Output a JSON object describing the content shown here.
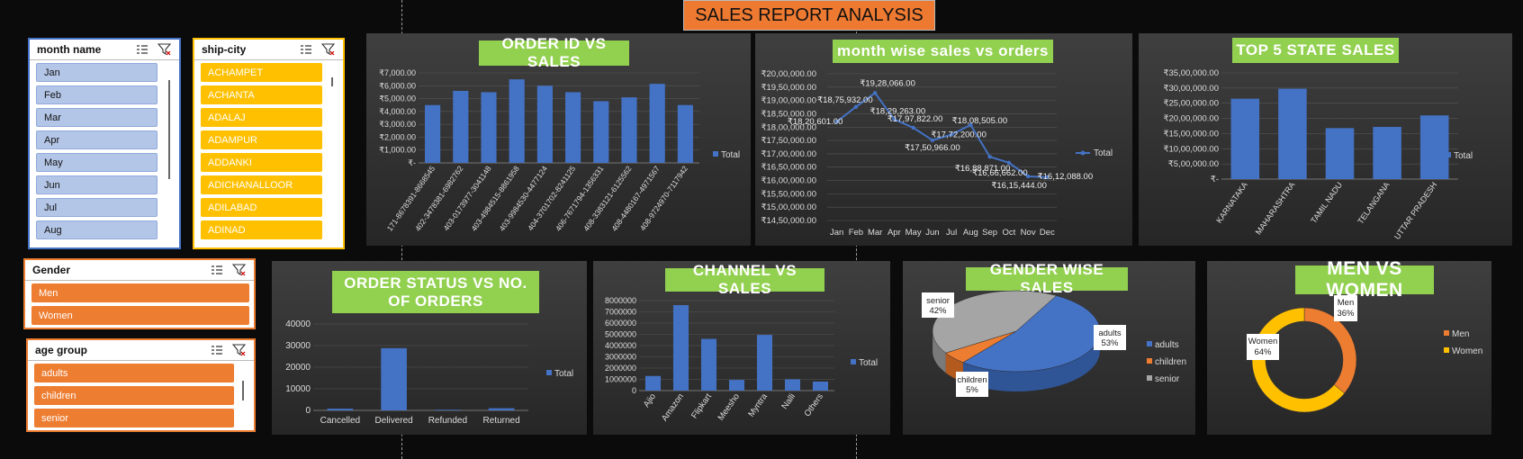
{
  "report_title": "SALES REPORT ANALYSIS",
  "colors": {
    "bar": "#4472c4",
    "title_bg": "#92d050",
    "orange": "#ed7d31",
    "yellow": "#ffc000",
    "banner": "#ee7a32",
    "grey": "#a5a5a5"
  },
  "slicers": {
    "month": {
      "title": "month name",
      "items": [
        "Jan",
        "Feb",
        "Mar",
        "Apr",
        "May",
        "Jun",
        "Jul",
        "Aug"
      ]
    },
    "city": {
      "title": "ship-city",
      "items": [
        "ACHAMPET",
        "ACHANTA",
        "ADALAJ",
        "ADAMPUR",
        "ADDANKI",
        "ADICHANALLOOR",
        "ADILABAD",
        "ADINAD"
      ]
    },
    "gender": {
      "title": "Gender",
      "items": [
        "Men",
        "Women"
      ]
    },
    "age": {
      "title": "age group",
      "items": [
        "adults",
        "children",
        "senior"
      ]
    }
  },
  "chart_data": [
    {
      "id": "order_sales",
      "type": "bar",
      "title": "ORDER ID VS SALES",
      "categories": [
        "171-8678391-8668545",
        "402-3478381-6982762",
        "403-0173977-3041148",
        "403-4984515-8861958",
        "403-9984530-4477124",
        "404-3701702-8241125",
        "406-7671794-1356331",
        "408-3383121-6125562",
        "408-4480167-4971567",
        "408-9724970-7117942"
      ],
      "values": [
        4500,
        5600,
        5500,
        6500,
        6000,
        5500,
        4800,
        5100,
        6150,
        4500
      ],
      "yticks": [
        "₹-",
        "₹1,000.00",
        "₹2,000.00",
        "₹3,000.00",
        "₹4,000.00",
        "₹5,000.00",
        "₹6,000.00",
        "₹7,000.00"
      ],
      "ylim": [
        0,
        7000
      ],
      "legend": "Total"
    },
    {
      "id": "month_sales",
      "type": "line",
      "title": "month wise sales vs orders",
      "categories": [
        "Jan",
        "Feb",
        "Mar",
        "Apr",
        "May",
        "Jun",
        "Jul",
        "Aug",
        "Sep",
        "Oct",
        "Nov",
        "Dec"
      ],
      "values": [
        1820601,
        1875932,
        1928066,
        1829263,
        1797822,
        1750966,
        1772200,
        1808505,
        1688871,
        1666662,
        1615444,
        1612088
      ],
      "labels": [
        "₹18,20,601.00",
        "₹18,75,932.00",
        "₹19,28,066.00",
        "₹18,29,263.00",
        "₹17,97,822.00",
        "₹17,50,966.00",
        "₹17,72,200.00",
        "₹18,08,505.00",
        "₹16,88,871.00",
        "₹16,66,662.00",
        "₹16,15,444.00",
        "₹16,12,088.00"
      ],
      "yticks": [
        "₹14,50,000.00",
        "₹15,00,000.00",
        "₹15,50,000.00",
        "₹16,00,000.00",
        "₹16,50,000.00",
        "₹17,00,000.00",
        "₹17,50,000.00",
        "₹18,00,000.00",
        "₹18,50,000.00",
        "₹19,00,000.00",
        "₹19,50,000.00",
        "₹20,00,000.00"
      ],
      "ylim": [
        1450000,
        2000000
      ],
      "legend": "Total"
    },
    {
      "id": "state_sales",
      "type": "bar",
      "title": "TOP 5 STATE SALES",
      "categories": [
        "KARNATAKA",
        "MAHARASHTRA",
        "TAMIL NADU",
        "TELANGANA",
        "UTTAR PRADESH"
      ],
      "values": [
        2650000,
        2980000,
        1680000,
        1720000,
        2100000
      ],
      "yticks": [
        "₹-",
        "₹5,00,000.00",
        "₹10,00,000.00",
        "₹15,00,000.00",
        "₹20,00,000.00",
        "₹25,00,000.00",
        "₹30,00,000.00",
        "₹35,00,000.00"
      ],
      "ylim": [
        0,
        3500000
      ],
      "legend": "Total"
    },
    {
      "id": "status_orders",
      "type": "bar",
      "title": "ORDER STATUS VS NO. OF ORDERS",
      "categories": [
        "Cancelled",
        "Delivered",
        "Refunded",
        "Returned"
      ],
      "values": [
        800,
        28800,
        300,
        1000
      ],
      "yticks": [
        "0",
        "10000",
        "20000",
        "30000",
        "40000"
      ],
      "ylim": [
        0,
        40000
      ],
      "legend": "Total"
    },
    {
      "id": "channel_sales",
      "type": "bar",
      "title": "CHANNEL VS SALES",
      "categories": [
        "Ajio",
        "Amazon",
        "Flipkart",
        "Meesho",
        "Myntra",
        "Nalli",
        "Others"
      ],
      "values": [
        1300000,
        7600000,
        4600000,
        950000,
        4950000,
        1000000,
        800000
      ],
      "yticks": [
        "0",
        "1000000",
        "2000000",
        "3000000",
        "4000000",
        "5000000",
        "6000000",
        "7000000",
        "8000000"
      ],
      "ylim": [
        0,
        8000000
      ],
      "legend": "Total"
    },
    {
      "id": "gender_sales",
      "type": "pie",
      "title": "GENDER WISE SALES",
      "categories": [
        "adults",
        "children",
        "senior"
      ],
      "values": [
        53,
        5,
        42
      ],
      "labels": [
        "adults 53%",
        "children 5%",
        "senior 42%"
      ],
      "legend": [
        "adults",
        "children",
        "senior"
      ]
    },
    {
      "id": "men_women",
      "type": "pie",
      "title": "MEN VS WOMEN",
      "categories": [
        "Men",
        "Women"
      ],
      "values": [
        36,
        64
      ],
      "labels": [
        "Men 36%",
        "Women 64%"
      ],
      "legend": [
        "Men",
        "Women"
      ]
    }
  ]
}
